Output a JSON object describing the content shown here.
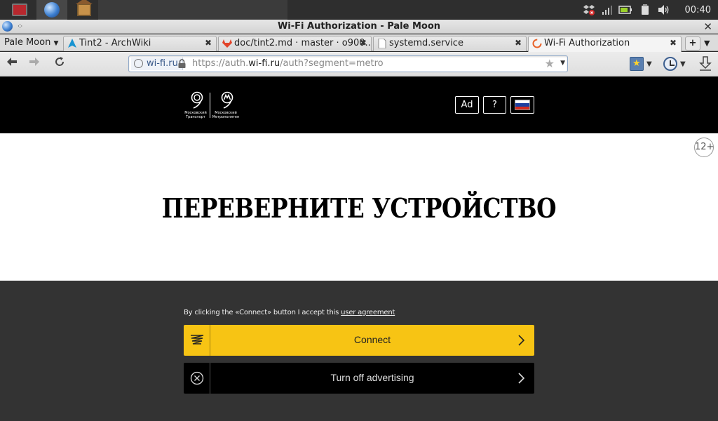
{
  "panel": {
    "clock": "00:40",
    "tasks": [
      "terminal-icon",
      "browser-globe-icon",
      "home-folder-icon"
    ],
    "tray_icons": [
      "dropbox-icon",
      "signal-icon",
      "battery-icon",
      "clipboard-icon",
      "volume-icon"
    ]
  },
  "window": {
    "title": "Wi-Fi Authorization - Pale Moon"
  },
  "tabs": {
    "app_menu": "Pale Moon",
    "items": [
      {
        "label": "Tint2 - ArchWiki",
        "icon": "arch-icon"
      },
      {
        "label": "doc/tint2.md · master · o900...",
        "icon": "gitlab-icon"
      },
      {
        "label": "systemd.service",
        "icon": "page-icon"
      },
      {
        "label": "Wi-Fi Authorization",
        "icon": "loading-icon",
        "active": true
      }
    ],
    "new_tab": "+"
  },
  "nav": {
    "identity": "wi-fi.ru",
    "url_prefix": "https://auth.",
    "url_domain": "wi-fi.ru",
    "url_path": "/auth?segment=metro"
  },
  "site": {
    "header": {
      "logo_left_caption": "Московский Транспорт",
      "logo_right_caption": "Московский Метрополитен",
      "ad_button": "Ad",
      "help_button": "?",
      "flag_colors": [
        "#ffffff",
        "#1c3fa0",
        "#d52b1e"
      ]
    },
    "age_rating": "12+",
    "headline": "ПЕРЕВЕРНИТЕ УСТРОЙСТВО",
    "agreement_text": "By clicking the «Connect» button I accept this ",
    "agreement_link": "user agreement",
    "connect_label": "Connect",
    "adoff_label": "Turn off advertising",
    "accent_color": "#f7c414"
  }
}
